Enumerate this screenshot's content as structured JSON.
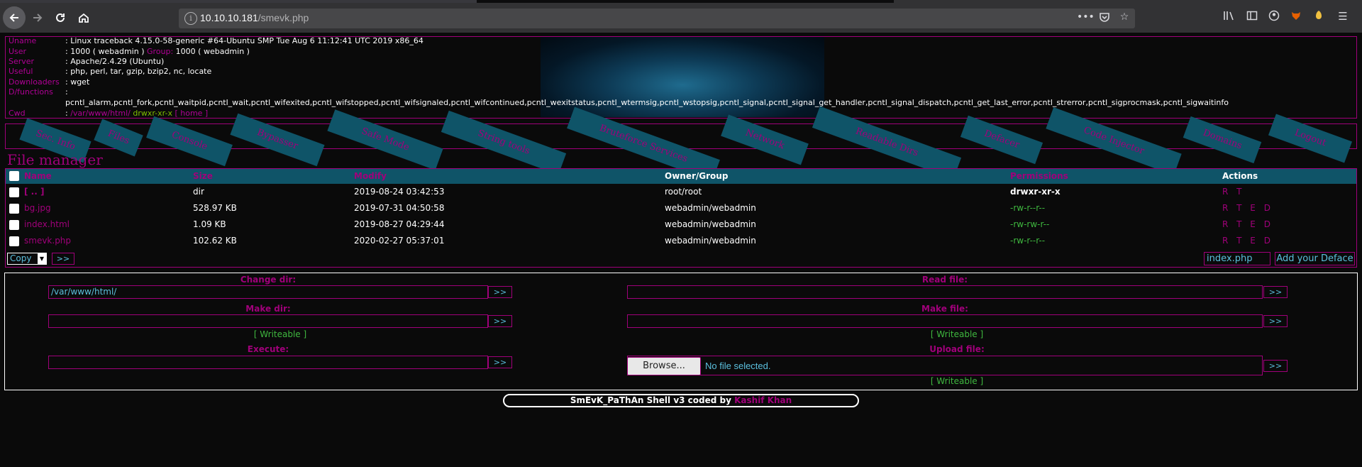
{
  "browser": {
    "url_host": "10.10.10.181",
    "url_path": "/smevk.php"
  },
  "info": {
    "rows": [
      {
        "key": "Uname",
        "value": ": Linux traceback 4.15.0-58-generic #64-Ubuntu SMP Tue Aug 6 11:12:41 UTC 2019 x86_64"
      },
      {
        "key": "User",
        "value_pre": ": 1000 ( webadmin ) ",
        "value_label": "Group:",
        "value_post": " 1000 ( webadmin )"
      },
      {
        "key": "Server",
        "value": ": Apache/2.4.29 (Ubuntu)"
      },
      {
        "key": "Useful",
        "value": ": php, perl, tar, gzip, bzip2, nc, locate"
      },
      {
        "key": "Downloaders",
        "value": ": wget"
      },
      {
        "key": "D/functions",
        "value": ":"
      },
      {
        "key": "Cwd",
        "value_sep": ": ",
        "value_path": "/var/www/html/",
        "value_perm": " drwxr-xr-x",
        "value_home": " [ home ]"
      }
    ],
    "disabled_functions": "pcntl_alarm,pcntl_fork,pcntl_waitpid,pcntl_wait,pcntl_wifexited,pcntl_wifstopped,pcntl_wifsignaled,pcntl_wifcontinued,pcntl_wexitstatus,pcntl_wtermsig,pcntl_wstopsig,pcntl_signal,pcntl_signal_get_handler,pcntl_signal_dispatch,pcntl_get_last_error,pcntl_strerror,pcntl_sigprocmask,pcntl_sigwaitinfo"
  },
  "menu": [
    "Sec. Info",
    "Files",
    "Console",
    "Bypasser",
    "Safe Mode",
    "String tools",
    "Bruteforce Services",
    "Network",
    "Readable Dirs",
    "Defacer",
    "Code Injector",
    "Domains",
    "Logout"
  ],
  "file_manager": {
    "title": "File manager",
    "columns": [
      "Name",
      "Size",
      "Modify",
      "Owner/Group",
      "Permissions",
      "Actions"
    ],
    "rows": [
      {
        "name": "[ .. ]",
        "size": "dir",
        "modify": "2019-08-24 03:42:53",
        "owner": "root/root",
        "perms": "drwxr-xr-x",
        "actions": "R T"
      },
      {
        "name": "bg.jpg",
        "size": "528.97 KB",
        "modify": "2019-07-31 04:50:58",
        "owner": "webadmin/webadmin",
        "perms": "-rw-r--r--",
        "actions": "R T E D"
      },
      {
        "name": "index.html",
        "size": "1.09 KB",
        "modify": "2019-08-27 04:29:44",
        "owner": "webadmin/webadmin",
        "perms": "-rw-rw-r--",
        "actions": "R T E D"
      },
      {
        "name": "smevk.php",
        "size": "102.62 KB",
        "modify": "2020-02-27 05:37:01",
        "owner": "webadmin/webadmin",
        "perms": "-rw-r--r--",
        "actions": "R T E D"
      }
    ],
    "copy_option": "Copy",
    "go_label": ">>",
    "deface_input": "index.php",
    "deface_button": "Add your Deface"
  },
  "tools": {
    "change_dir": {
      "label": "Change dir:",
      "value": "/var/www/html/"
    },
    "read_file": {
      "label": "Read file:",
      "value": ""
    },
    "make_dir": {
      "label": "Make dir:",
      "value": "",
      "status": "[ Writeable ]"
    },
    "make_file": {
      "label": "Make file:",
      "value": "",
      "status": "[ Writeable ]"
    },
    "execute": {
      "label": "Execute:",
      "value": ""
    },
    "upload_file": {
      "label": "Upload file:",
      "browse": "Browse...",
      "no_file": "No file selected.",
      "status": "[ Writeable ]"
    },
    "go_label": ">>"
  },
  "footer": {
    "text": "SmEvK_PaThAn Shell v3 coded by ",
    "author": "Kashif Khan"
  },
  "colors": {
    "accent": "#a0007a",
    "menu_bg": "#0f5468",
    "writeable": "#3fb83f",
    "input_text": "#5bc0de"
  }
}
